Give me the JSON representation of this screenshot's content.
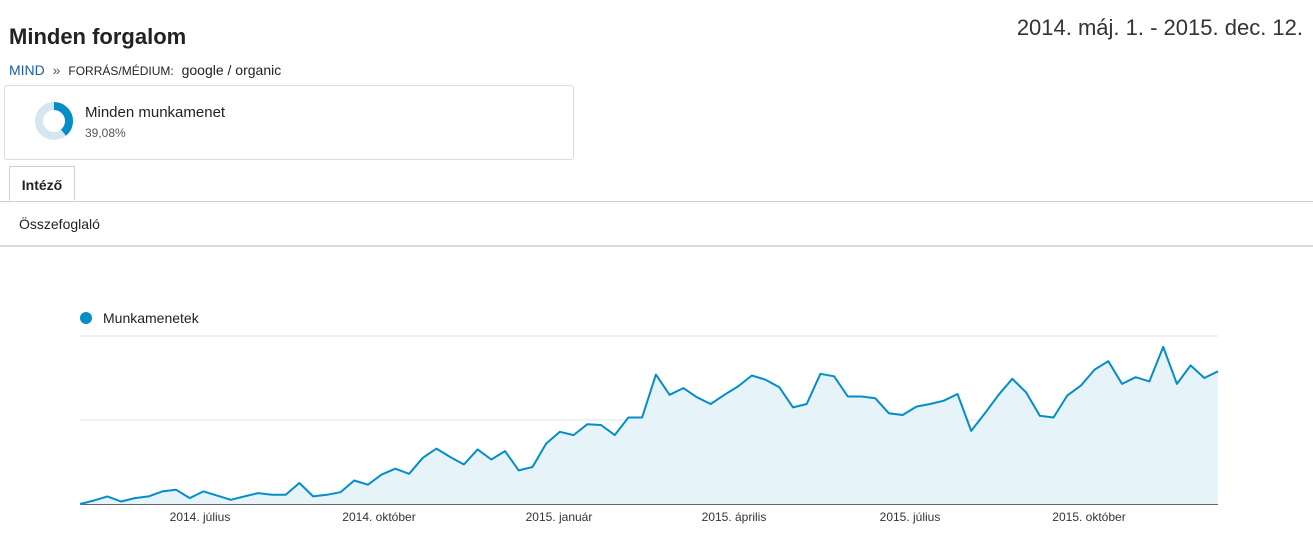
{
  "header": {
    "title": "Minden forgalom",
    "date_range": "2014. máj. 1. - 2015. dec. 12."
  },
  "breadcrumb": {
    "root": "MIND",
    "separator": "»",
    "dimension": "FORRÁS/MÉDIUM:",
    "value": "google / organic"
  },
  "segment": {
    "name": "Minden munkamenet",
    "percent": "39,08%",
    "share": 0.3908,
    "color": "#058dc7"
  },
  "tabs": {
    "active": "Intéző"
  },
  "subtab": {
    "label": "Összefoglaló"
  },
  "chart_data": {
    "type": "area",
    "series": [
      {
        "name": "Munkamenetek",
        "color": "#058dc7",
        "values": [
          0,
          4,
          9,
          3,
          7,
          9,
          15,
          17,
          7,
          15,
          10,
          5,
          9,
          13,
          11,
          11,
          25,
          9,
          11,
          14,
          28,
          23,
          35,
          42,
          36,
          55,
          66,
          56,
          47,
          65,
          53,
          63,
          40,
          44,
          72,
          86,
          82,
          95,
          94,
          82,
          103,
          103,
          154,
          130,
          138,
          127,
          119,
          130,
          140,
          153,
          148,
          139,
          115,
          119,
          155,
          152,
          128,
          128,
          126,
          108,
          106,
          116,
          119,
          123,
          131,
          87,
          108,
          130,
          149,
          133,
          105,
          103,
          129,
          141,
          160,
          170,
          143,
          151,
          146,
          187,
          143,
          165,
          150,
          158
        ]
      }
    ],
    "x_tick_labels": [
      "2014. július",
      "2014. október",
      "2015. január",
      "2015. április",
      "2015. július",
      "2015. október"
    ],
    "ylim": [
      0,
      200
    ],
    "grid": true,
    "legend": "top-left",
    "fill": "#e6f3f9"
  }
}
